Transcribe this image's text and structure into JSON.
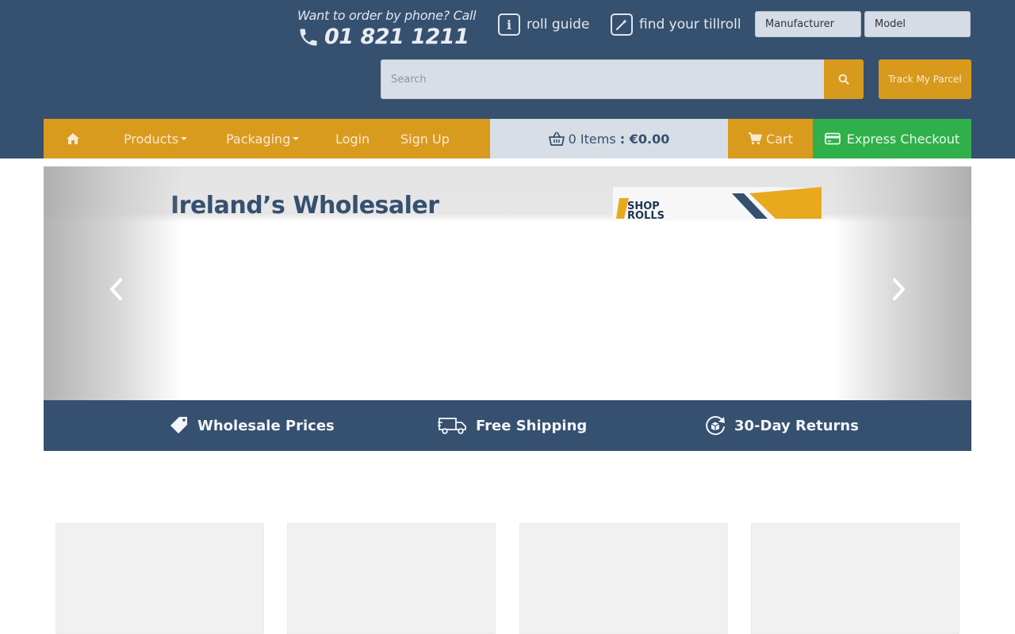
{
  "header": {
    "phone_prompt": "Want to order by phone? Call",
    "phone_number": "01 821 1211",
    "roll_guide_label": "roll guide",
    "find_tillroll_label": "find your tillroll",
    "manufacturer_select": "Manufacturer",
    "model_select": "Model",
    "search_placeholder": "Search",
    "track_parcel_label": "Track My Parcel"
  },
  "nav": {
    "items": [
      {
        "label": "Products"
      },
      {
        "label": "Packaging"
      },
      {
        "label": "Login"
      },
      {
        "label": "Sign Up"
      }
    ],
    "cart_count": "0 Items",
    "cart_total": ": €0.00",
    "cart_label": "Cart",
    "express_checkout_label": "Express Checkout"
  },
  "banner": {
    "title": "Ireland’s Wholesaler",
    "logo_text_1": "SHOP",
    "logo_text_2": "ROLLS"
  },
  "benefits": [
    {
      "label": "Wholesale Prices",
      "icon": "price-tag-icon"
    },
    {
      "label": "Free Shipping",
      "icon": "delivery-truck-icon"
    },
    {
      "label": "30-Day Returns",
      "icon": "returns-box-icon"
    }
  ],
  "colors": {
    "header_bg": "#36506f",
    "accent_orange": "#d99b1e",
    "express_green": "#2fb04a",
    "cart_summary_bg": "#d8dee6"
  }
}
